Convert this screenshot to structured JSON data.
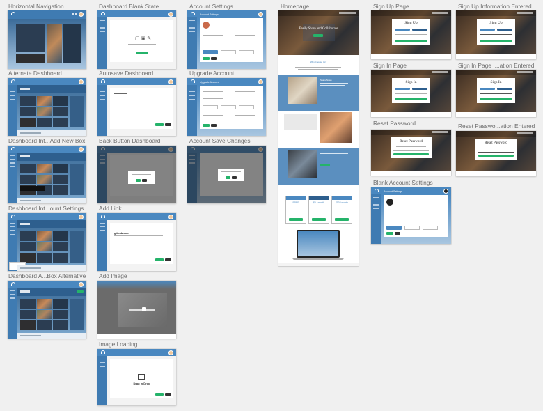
{
  "columns": [
    {
      "items": [
        {
          "label": "Horizontal Navigation",
          "kind": "dash-horizontal"
        },
        {
          "label": "Alternate Dashboard",
          "kind": "dash-grid"
        },
        {
          "label": "Dashboard Int...Add New Box",
          "kind": "dash-grid"
        },
        {
          "label": "Dashboard Int...ount Settings",
          "kind": "dash-grid-menu"
        },
        {
          "label": "Dashboard A...Box Alternative",
          "kind": "dash-grid-green"
        }
      ]
    },
    {
      "items": [
        {
          "label": "Dashboard Blank State",
          "kind": "blank-state"
        },
        {
          "label": "Autosave Dashboard",
          "kind": "autosave"
        },
        {
          "label": "Back Button Dashboard",
          "kind": "back-button"
        },
        {
          "label": "Add Link",
          "kind": "add-link",
          "link_text": "github.com"
        },
        {
          "label": "Add Image",
          "kind": "add-image"
        },
        {
          "label": "Image Loading",
          "kind": "image-loading",
          "drag_text": "Drag 'n Drop"
        }
      ]
    },
    {
      "items": [
        {
          "label": "Account Settings",
          "kind": "account",
          "header": "Account Settings"
        },
        {
          "label": "Upgrade Account",
          "kind": "upgrade",
          "header": "Upgrade Account"
        },
        {
          "label": "Account Save Changes",
          "kind": "account-save"
        }
      ]
    },
    {
      "items": [
        {
          "label": "Homepage",
          "kind": "homepage",
          "hero_text": "Easily Share and Collaborate",
          "section_heading": "Why Choose Us?",
          "card_heading": "Share Notes",
          "prices": [
            "FREE",
            "$5 / month",
            "$10 / month"
          ]
        }
      ]
    },
    {
      "items": [
        {
          "label": "Sign Up Page",
          "kind": "auth",
          "title": "Sign Up"
        },
        {
          "label": "Sign In Page",
          "kind": "auth",
          "title": "Sign In"
        },
        {
          "label": "Reset Password",
          "kind": "reset",
          "title": "Reset Password"
        },
        {
          "label": "Blank Account Settings",
          "kind": "account-blank",
          "header": "Account Settings"
        }
      ]
    },
    {
      "items": [
        {
          "label": "Sign Up Information Entered",
          "kind": "auth",
          "title": "Sign Up"
        },
        {
          "label": "Sign In Page I...ation Entered",
          "kind": "auth",
          "title": "Sign In"
        },
        {
          "label": "Reset Passwo...ation Entered",
          "kind": "reset",
          "title": "Reset Password"
        }
      ]
    }
  ]
}
